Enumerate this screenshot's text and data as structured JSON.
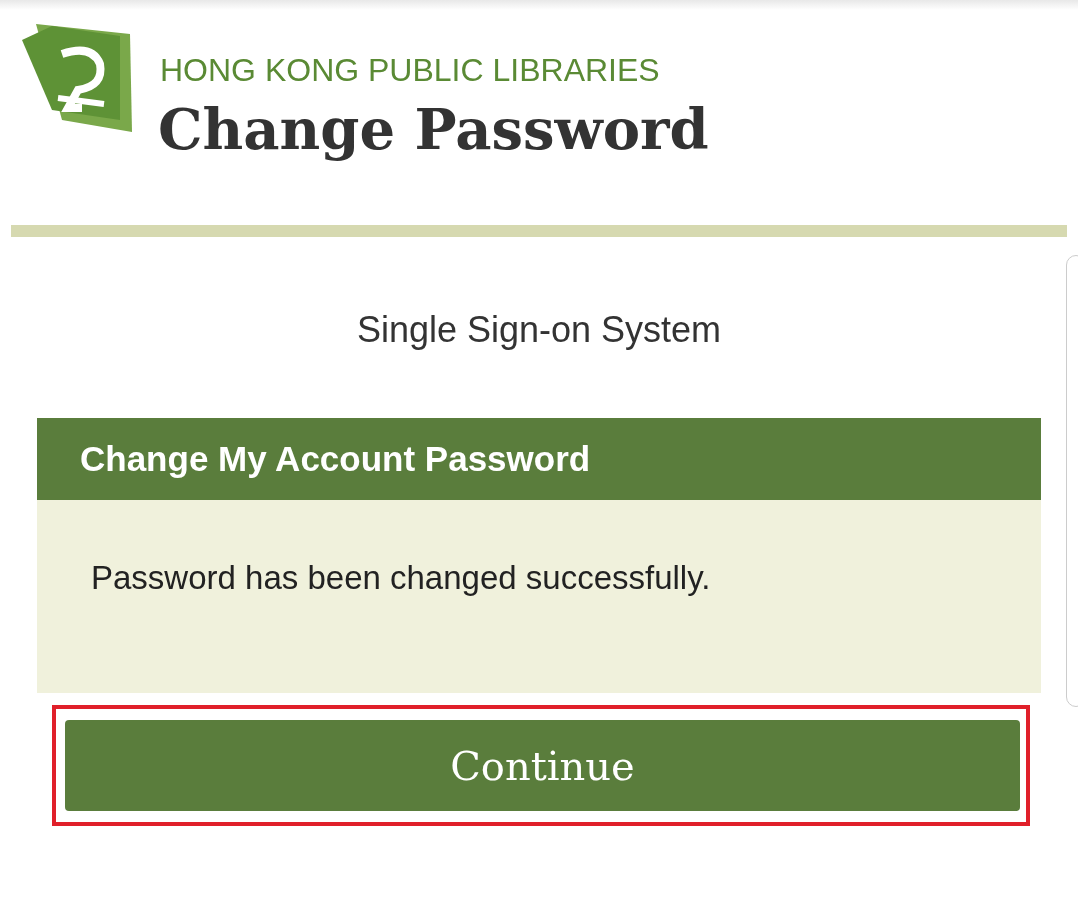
{
  "header": {
    "organization": "HONG KONG PUBLIC LIBRARIES",
    "title": "Change Password"
  },
  "system_name": "Single Sign-on System",
  "panel": {
    "heading": "Change My Account Password",
    "message": "Password has been changed successfully."
  },
  "continue_button": {
    "label": "Continue",
    "highlighted": true
  }
}
